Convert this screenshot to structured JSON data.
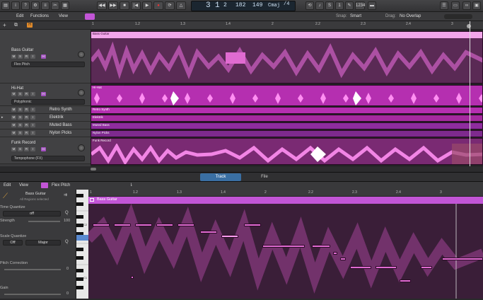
{
  "toolbar": {
    "edit": "Edit",
    "functions": "Functions",
    "view": "View",
    "lcd": {
      "bar": "3",
      "beat": "1",
      "sub": "2",
      "tempo": "182",
      "sig_top": "149",
      "key": "Cmaj",
      "sig_label": "/4"
    },
    "counter": "1234"
  },
  "arrange": {
    "snap_label": "Snap:",
    "snap_value": "Smart",
    "drag_label": "Drag:",
    "drag_value": "No Overlap",
    "ruler": [
      "1",
      "1.2",
      "1.3",
      "1.4",
      "2",
      "2.2",
      "2.3",
      "2.4",
      "3"
    ],
    "tracks": [
      {
        "num": "",
        "name": "Bass Guitar",
        "mode": "Flex Pitch",
        "region": "Bass Guitar"
      },
      {
        "num": "",
        "name": "Hi-Hat",
        "mode": "Polyphonic",
        "region": "Hi-Hat"
      },
      {
        "num": "",
        "name": "Retro Synth",
        "region": "Retro Synth"
      },
      {
        "num": "",
        "name": "Elektrik",
        "region": "Elektrik"
      },
      {
        "num": "",
        "name": "Muted Bass",
        "region": "Muted Bass"
      },
      {
        "num": "",
        "name": "Nylon Picks",
        "region": "Nylon Picks"
      },
      {
        "num": "",
        "name": "Funk Record",
        "mode": "Tempophone (FX)",
        "region": "Funk Record"
      }
    ],
    "msr": [
      "M",
      "S",
      "R",
      "I"
    ]
  },
  "tabs": {
    "track": "Track",
    "file": "File"
  },
  "editor": {
    "edit": "Edit",
    "view": "View",
    "mode": "Flex Pitch",
    "region_name": "Bass Guitar",
    "region_sub": "All Regions selected",
    "ruler": [
      "1",
      "1.2",
      "1.3",
      "1.4",
      "2",
      "2.2",
      "2.3",
      "2.4",
      "3"
    ],
    "time_quantize": "Time Quantize",
    "tq_value": "off",
    "strength": "Strength",
    "strength_value": "100",
    "scale_quantize": "Scale Quantize",
    "sq_off": "Off",
    "sq_scale": "Major",
    "pitch_correction": "Pitch Correction",
    "pc_value": "0",
    "gain": "Gain",
    "gain_value": "0",
    "keys": {
      "c2": "C2",
      "c1": "C1"
    }
  }
}
